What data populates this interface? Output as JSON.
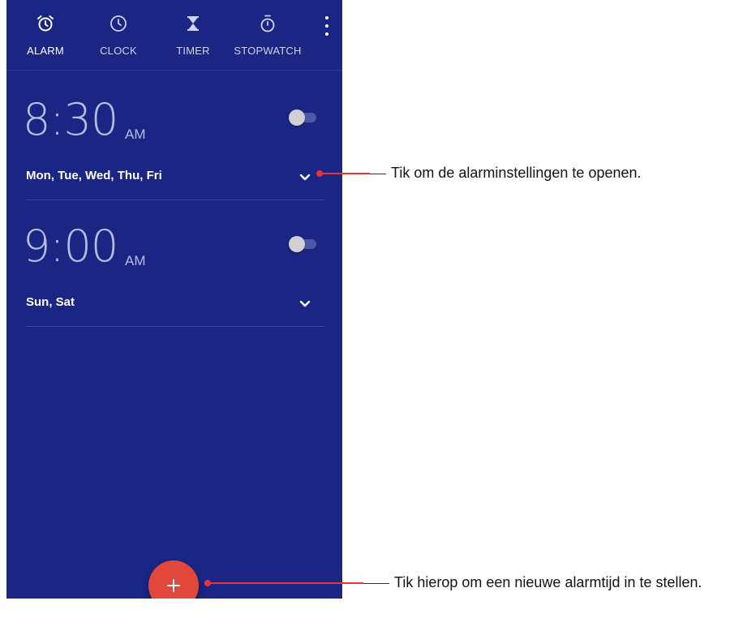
{
  "tabs": [
    {
      "label": "ALARM",
      "icon": "alarm-clock-icon",
      "active": true
    },
    {
      "label": "CLOCK",
      "icon": "clock-icon",
      "active": false
    },
    {
      "label": "TIMER",
      "icon": "hourglass-icon",
      "active": false
    },
    {
      "label": "STOPWATCH",
      "icon": "stopwatch-icon",
      "active": false
    }
  ],
  "menu_icon": "more-vert-icon",
  "alarms": [
    {
      "time": "8:30",
      "ampm": "AM",
      "days": "Mon, Tue, Wed, Thu, Fri",
      "enabled": false
    },
    {
      "time": "9:00",
      "ampm": "AM",
      "days": "Sun, Sat",
      "enabled": false
    }
  ],
  "fab": {
    "label": "+",
    "icon": "add-icon"
  },
  "annotations": {
    "settings": "Tik om de alarminstellingen te openen.",
    "new_alarm": "Tik hierop om een nieuwe alarmtijd in te stellen."
  },
  "colors": {
    "background": "#1a2584",
    "fab": "#e2473b",
    "callout_line": "#e8323a"
  }
}
